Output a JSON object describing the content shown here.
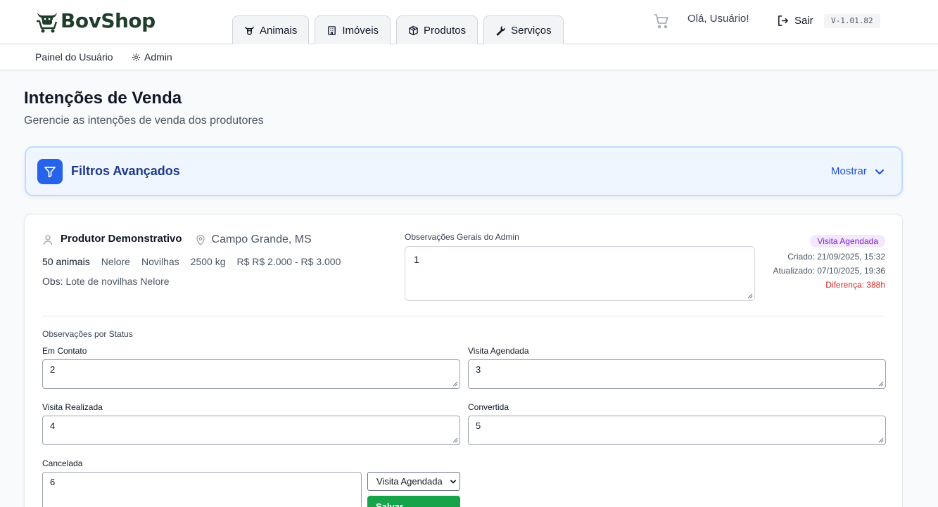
{
  "header": {
    "brand": "BovShop",
    "tabs": [
      {
        "label": "Animais",
        "icon": "cow-icon"
      },
      {
        "label": "Imóveis",
        "icon": "building-icon"
      },
      {
        "label": "Produtos",
        "icon": "box-icon"
      },
      {
        "label": "Serviços",
        "icon": "wrench-icon"
      }
    ],
    "greeting": "Olá, Usuário!",
    "logout_label": "Sair",
    "version": "V-1.01.82"
  },
  "subnav": {
    "items": [
      {
        "label": "Painel do Usuário"
      },
      {
        "label": "Admin",
        "icon": "gear-icon"
      }
    ]
  },
  "page": {
    "title": "Intenções de Venda",
    "subtitle": "Gerencie as intenções de venda dos produtores"
  },
  "filters": {
    "title": "Filtros Avançados",
    "toggle_label": "Mostrar"
  },
  "intention": {
    "producer": "Produtor Demonstrativo",
    "location": "Campo Grande, MS",
    "specs": {
      "quantity": "50 animais",
      "breed": "Nelore",
      "category": "Novilhas",
      "weight": "2500 kg",
      "price": "R$ R$ 2.000 - R$ 3.000"
    },
    "obs_label": "Obs:",
    "obs_value": "Lote de novilhas Nelore",
    "admin_obs_label": "Observações Gerais do Admin",
    "admin_obs_value": "1",
    "status_badge": "Visita Agendada",
    "created": "Criado: 21/09/2025, 15:32",
    "updated": "Atualizado: 07/10/2025, 19:36",
    "difference": "Diferença: 388h",
    "status_obs_title": "Observações por Status",
    "status_fields": [
      {
        "label": "Em Contato",
        "value": "2"
      },
      {
        "label": "Visita Agendada",
        "value": "3"
      },
      {
        "label": "Visita Realizada",
        "value": "4"
      },
      {
        "label": "Convertida",
        "value": "5"
      },
      {
        "label": "Cancelada",
        "value": "6"
      }
    ],
    "status_select": "Visita Agendada",
    "save_label": "Salvar"
  },
  "colors": {
    "brand": "#1f3d2b",
    "filters_accent": "#2563eb",
    "badge_bg": "#f3e8ff",
    "badge_text": "#7e22ce",
    "diff_text": "#dc2626",
    "save_button": "#16a34a"
  }
}
